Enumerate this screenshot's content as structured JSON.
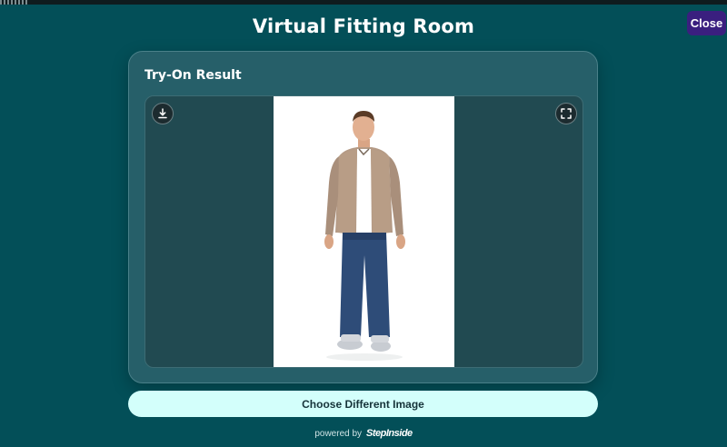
{
  "page": {
    "title": "Virtual Fitting Room"
  },
  "close_button": {
    "label": "Close"
  },
  "result_card": {
    "title": "Try-On Result",
    "download_icon": "download-icon",
    "fullscreen_icon": "expand-icon",
    "photo": {
      "subject": "man-in-suede-jacket-and-jeans"
    }
  },
  "actions": {
    "choose_label": "Choose Different Image"
  },
  "footer": {
    "powered_by": "powered by",
    "brand": "StepInside"
  },
  "colors": {
    "background": "#034f58",
    "card": "#265f69",
    "viewer": "#214a51",
    "close_button": "#3a1f7f",
    "choose_button": "#d3fffb"
  }
}
